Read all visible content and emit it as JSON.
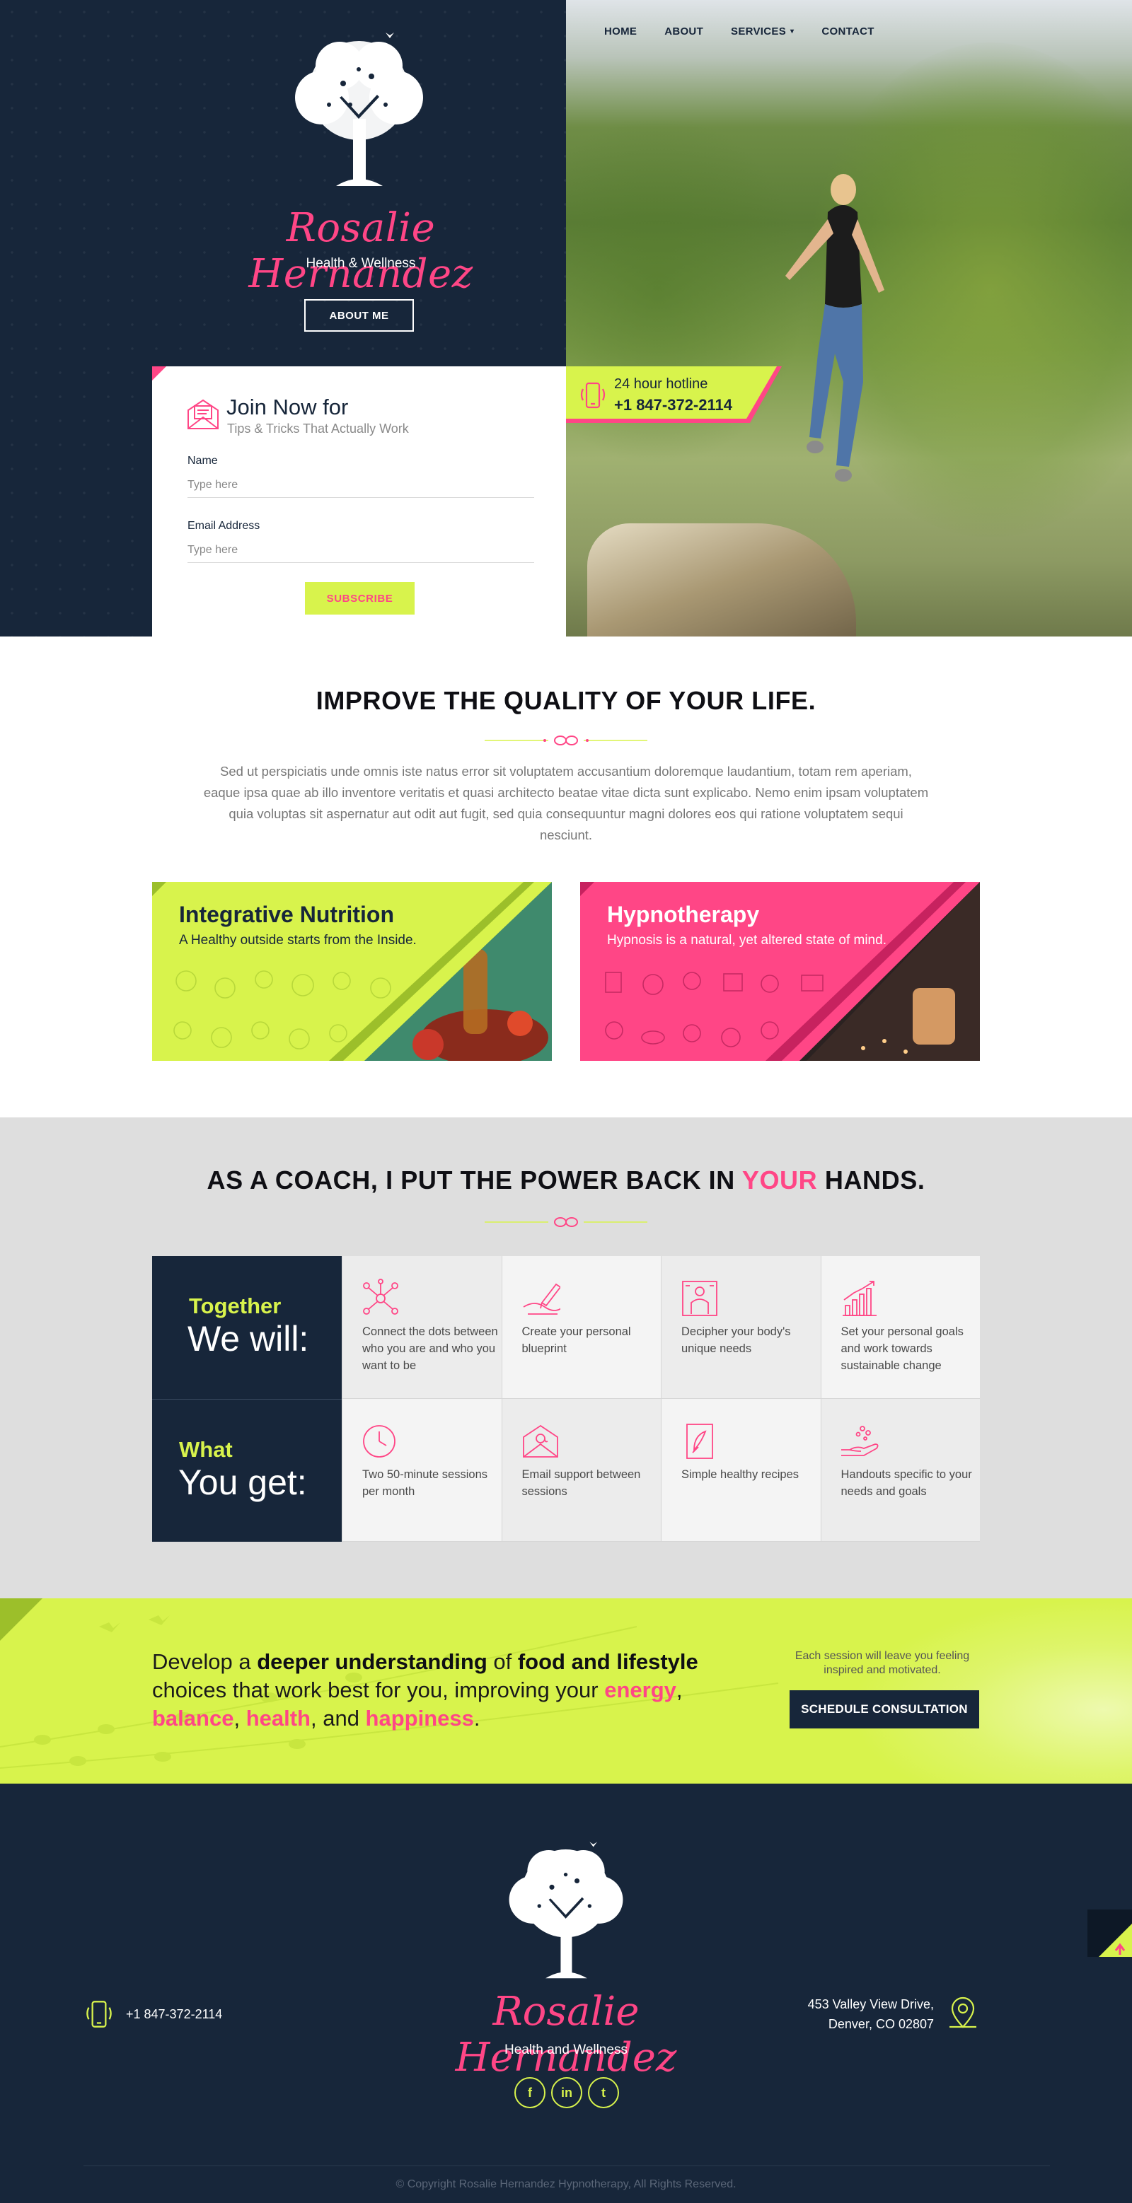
{
  "nav": {
    "items": [
      {
        "label": "HOME"
      },
      {
        "label": "ABOUT"
      },
      {
        "label": "SERVICES"
      },
      {
        "label": "CONTACT"
      }
    ]
  },
  "hero": {
    "brand_name": "Rosalie Hernandez",
    "tagline": "Health & Wellness",
    "about_button": "ABOUT ME"
  },
  "join": {
    "title": "Join Now for",
    "subtitle": "Tips & Tricks That Actually Work",
    "name_label": "Name",
    "name_placeholder": "Type here",
    "email_label": "Email Address",
    "email_placeholder": "Type here",
    "subscribe_label": "SUBSCRIBE"
  },
  "hotline": {
    "label": "24 hour hotline",
    "number": "+1 847-372-2114"
  },
  "improve": {
    "title": "IMPROVE THE QUALITY OF YOUR LIFE.",
    "body": "Sed ut perspiciatis unde omnis iste natus error sit voluptatem accusantium doloremque laudantium, totam rem aperiam, eaque ipsa quae ab illo inventore veritatis et quasi architecto beatae vitae dicta sunt explicabo. Nemo enim ipsam voluptatem quia voluptas sit aspernatur aut odit aut fugit, sed quia consequuntur magni dolores eos qui ratione voluptatem sequi nesciunt."
  },
  "services": [
    {
      "title": "Integrative Nutrition",
      "desc": "A Healthy outside starts from the Inside."
    },
    {
      "title": "Hypnotherapy",
      "desc": "Hypnosis is a natural, yet altered state of mind."
    }
  ],
  "coach": {
    "title_pre": "AS A COACH, I PUT THE POWER BACK IN ",
    "title_hl": "YOUR",
    "title_post": " HANDS.",
    "rows": [
      {
        "accent": "Together",
        "big": "We will:",
        "cells": [
          {
            "icon": "network-icon",
            "text": "Connect the dots between who you are and who you want to be"
          },
          {
            "icon": "pen-blueprint-icon",
            "text": "Create your personal blueprint"
          },
          {
            "icon": "person-analysis-icon",
            "text": "Decipher your body's unique needs"
          },
          {
            "icon": "growth-chart-icon",
            "text": "Set your personal goals and work towards sustainable change"
          }
        ]
      },
      {
        "accent": "What",
        "big": "You get:",
        "cells": [
          {
            "icon": "clock-icon",
            "text": "Two 50-minute sessions per month"
          },
          {
            "icon": "email-icon",
            "text": "Email support between sessions"
          },
          {
            "icon": "recipe-book-icon",
            "text": "Simple healthy recipes"
          },
          {
            "icon": "hand-sparkle-icon",
            "text": "Handouts specific to your needs and goals"
          }
        ]
      }
    ]
  },
  "cta": {
    "t1": "Develop a ",
    "t2": "deeper understanding",
    "t3": " of ",
    "t4": "food and lifestyle",
    "t5": " choices that work best for you, improving your ",
    "t6": "energy",
    "t7": ",",
    "t8": "balance",
    "t9": ", ",
    "t10": "health",
    "t11": ", and ",
    "t12": "happiness",
    "t13": ".",
    "note": "Each session will leave you feeling inspired and motivated.",
    "button": "SCHEDULE CONSULTATION"
  },
  "footer": {
    "brand_name": "Rosalie Hernandez",
    "tagline": "Health and Wellness",
    "phone": "+1 847-372-2114",
    "address_line1": "453 Valley View Drive,",
    "address_line2": "Denver, CO 02807",
    "social": [
      {
        "label": "f",
        "icon": "facebook-icon"
      },
      {
        "label": "in",
        "icon": "linkedin-icon"
      },
      {
        "label": "t",
        "icon": "twitter-icon"
      }
    ],
    "copyright": "© Copyright Rosalie Hernandez Hypnotherapy, All Rights Reserved."
  },
  "colors": {
    "navy": "#17263a",
    "pink": "#ff4686",
    "lime": "#d8f34c"
  }
}
